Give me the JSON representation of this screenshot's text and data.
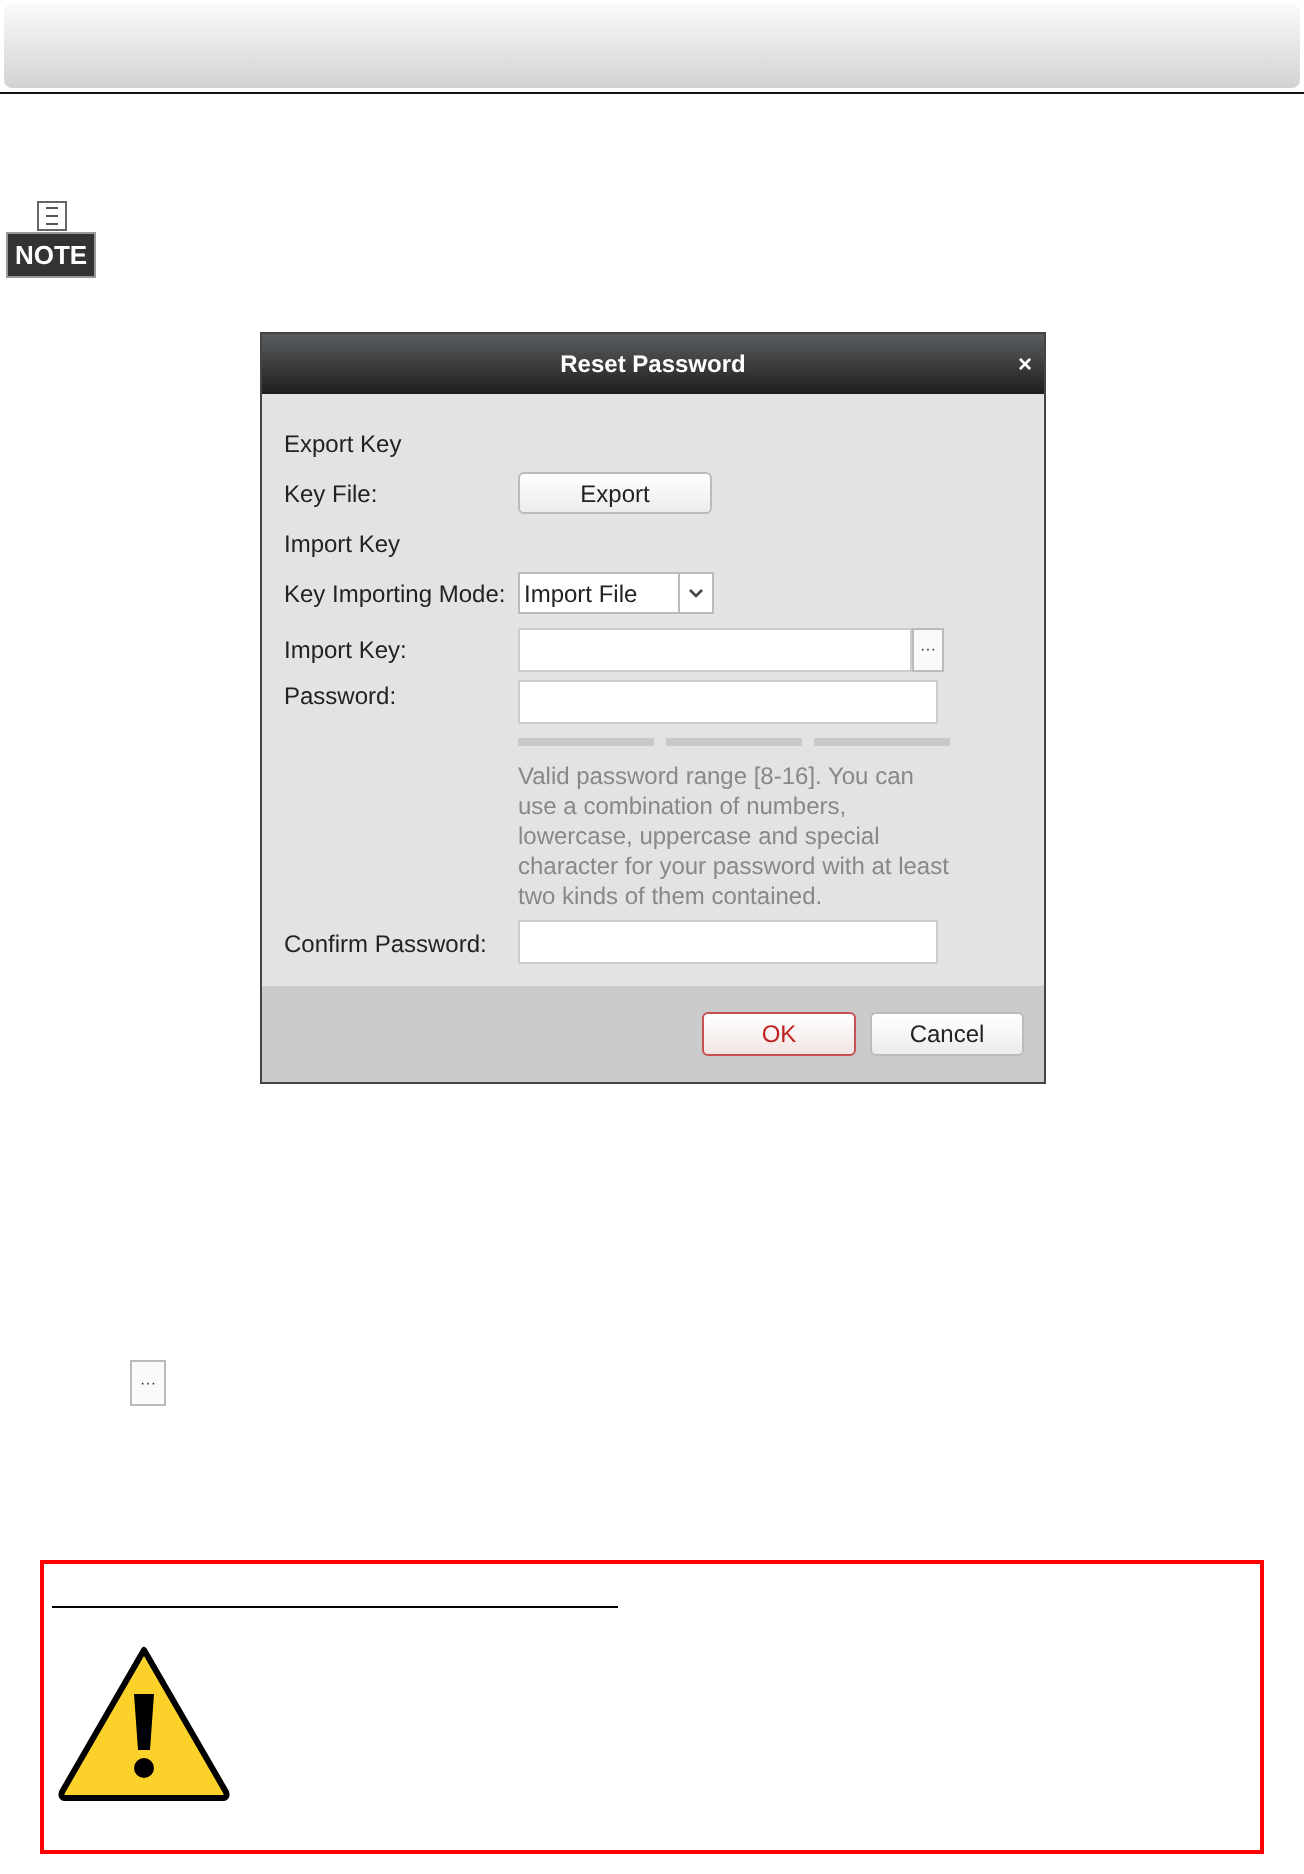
{
  "note_badge": {
    "text": "NOTE"
  },
  "dialog": {
    "title": "Reset Password",
    "close": "×",
    "sections": [
      {
        "kind": "heading",
        "label": "Export Key"
      },
      {
        "kind": "button",
        "label": "Key File:",
        "button": "Export"
      },
      {
        "kind": "heading",
        "label": "Import Key"
      },
      {
        "kind": "select",
        "label": "Key Importing Mode:",
        "value": "Import File"
      },
      {
        "kind": "browse",
        "label": "Import Key:",
        "browse": "···"
      },
      {
        "kind": "password",
        "label": "Password:",
        "hint": "Valid password range [8-16]. You can use a combination of numbers, lowercase, uppercase and special character for your password with at least two kinds of them contained."
      },
      {
        "kind": "input",
        "label": "Confirm Password:"
      }
    ],
    "buttons": [
      {
        "label": "OK",
        "default": true
      },
      {
        "label": "Cancel",
        "default": false
      }
    ]
  },
  "inline_browse_button": "···"
}
